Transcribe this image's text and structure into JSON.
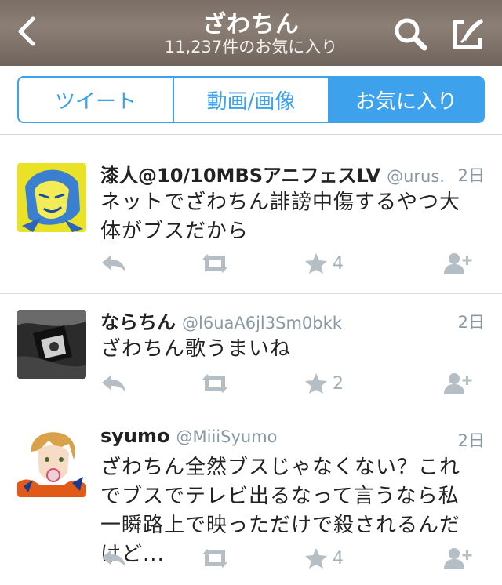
{
  "header": {
    "title": "ざわちん",
    "subtitle": "11,237件のお気に入り"
  },
  "tabs": [
    {
      "label": "ツイート",
      "active": false
    },
    {
      "label": "動画/画像",
      "active": false
    },
    {
      "label": "お気に入り",
      "active": true
    }
  ],
  "tweets": [
    {
      "display_name": "漆人@10/10MBSアニフェスLV",
      "handle": "@urus...",
      "time": "2日",
      "text": "ネットでざわちん誹謗中傷するやつ大体がブスだから",
      "favorites": "4"
    },
    {
      "display_name": "ならちん",
      "handle": "@l6uaA6jl3Sm0bkk",
      "time": "2日",
      "text": "ざわちん歌うまいね",
      "favorites": "2"
    },
    {
      "display_name": "syumo",
      "handle": "@MiiiSyumo",
      "time": "2日",
      "text": "ざわちん全然ブスじゃなくない？これでブスでテレビ出るなって言うなら私一瞬路上で映っただけで殺されるんだけど...",
      "favorites": "4"
    }
  ],
  "colors": {
    "accent": "#3da1ec",
    "muted": "#a3aeb6"
  }
}
